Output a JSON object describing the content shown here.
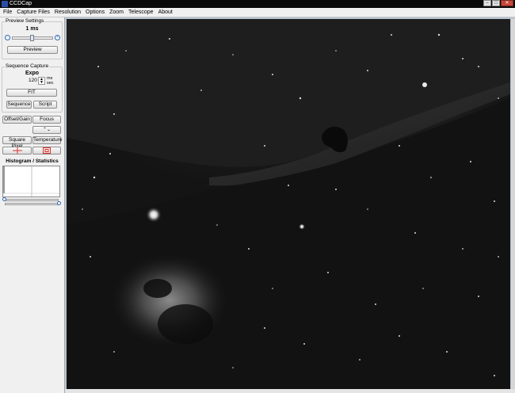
{
  "window": {
    "title": "CCDCap"
  },
  "menu": [
    "File",
    "Capture Files",
    "Resolution",
    "Options",
    "Zoom",
    "Telescope",
    "About"
  ],
  "preview": {
    "legend": "Preview Settings",
    "exposure": "1 ms",
    "minus": "-",
    "plus": "+",
    "button": "Preview"
  },
  "sequence": {
    "legend": "Sequence Capture",
    "expo_label": "Expo",
    "expo_value": "120",
    "unit_ms": "ms",
    "unit_sec": "sec",
    "fit": "FIT",
    "sequence": "Sequence",
    "script": "Script"
  },
  "tools": {
    "offset_gain": "Offset/Gain",
    "focus": "Focus",
    "square_pixel": "Square Pixel",
    "temperature": "Temperature"
  },
  "histogram": {
    "title": "Histogram / Statistics"
  },
  "colors": {
    "accent": "#2b64b5",
    "crosshair": "#e0312a"
  }
}
